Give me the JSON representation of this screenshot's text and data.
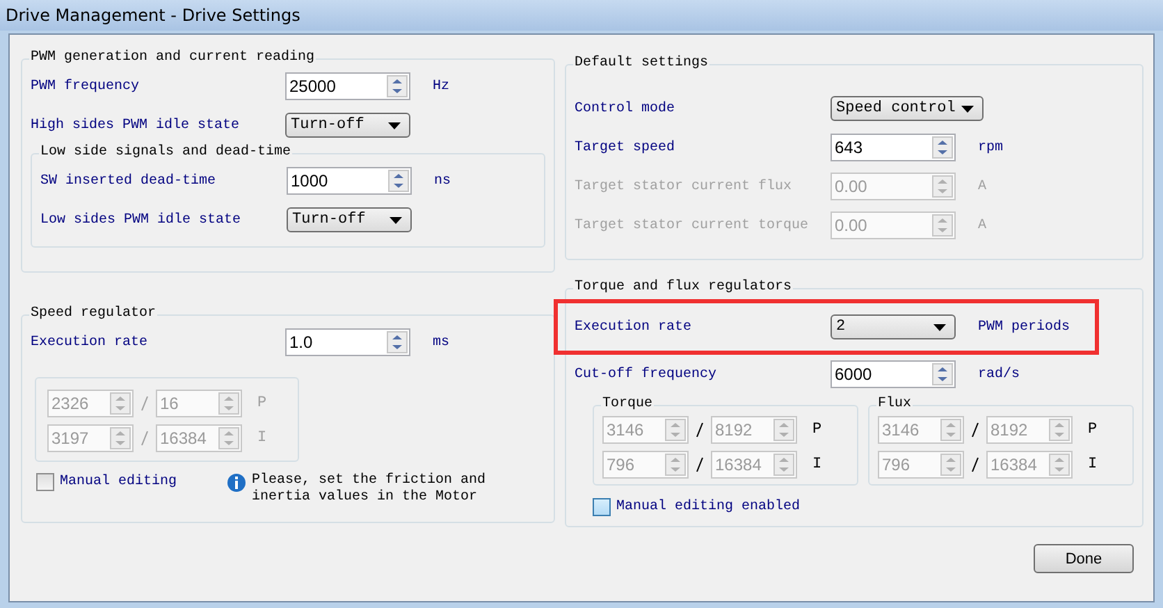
{
  "window": {
    "title": "Drive Management - Drive Settings"
  },
  "columns": [
    [
      {
        "title": "PWM generation and current reading",
        "rows": [
          {
            "kind": "spin",
            "label": "PWM frequency",
            "value": "25000",
            "unit": "Hz",
            "disabled": false,
            "highlighted": false
          },
          {
            "kind": "combo",
            "label": "High sides PWM idle state",
            "value": "Turn-off",
            "disabled": false,
            "highlighted": false
          }
        ],
        "subgroup": {
          "title": "Low side signals and dead-time",
          "rows": [
            {
              "kind": "spin",
              "label": "SW inserted dead-time",
              "value": "1000",
              "unit": "ns",
              "disabled": false,
              "highlighted": false
            },
            {
              "kind": "combo",
              "label": "Low sides PWM idle state",
              "value": "Turn-off",
              "disabled": false,
              "highlighted": false
            }
          ]
        }
      },
      {
        "title": "Speed regulator",
        "rows": [
          {
            "kind": "spin",
            "label": "Execution rate",
            "value": "1.0",
            "unit": "ms",
            "disabled": false,
            "highlighted": false
          }
        ],
        "gain_sets": [
          {
            "labels_disabled": true,
            "fields_disabled": true,
            "rows": [
              {
                "numerator": "2326",
                "denominator": "16",
                "label": "P"
              },
              {
                "numerator": "3197",
                "denominator": "16384",
                "label": "I"
              }
            ]
          }
        ],
        "checkbox": {
          "label": "Manual editing",
          "checked": false,
          "focused": false
        },
        "note": "Please, set the friction and inertia values in the Motor"
      }
    ],
    [
      {
        "title": "Default settings",
        "rows": [
          {
            "kind": "combo",
            "label": "Control mode",
            "value": "Speed control",
            "disabled": false,
            "highlighted": false
          },
          {
            "kind": "spin",
            "label": "Target speed",
            "value": "643",
            "unit": "rpm",
            "disabled": false,
            "highlighted": false
          },
          {
            "kind": "spin",
            "label": "Target stator current flux",
            "value": "0.00",
            "unit": "A",
            "disabled": true,
            "highlighted": false
          },
          {
            "kind": "spin",
            "label": "Target stator current torque",
            "value": "0.00",
            "unit": "A",
            "disabled": true,
            "highlighted": false
          }
        ]
      },
      {
        "title": "Torque and flux regulators",
        "rows": [
          {
            "kind": "combo",
            "label": "Execution rate",
            "value": "2",
            "unit": "PWM periods",
            "disabled": false,
            "highlighted": true
          },
          {
            "kind": "spin",
            "label": "Cut-off frequency",
            "value": "6000",
            "unit": "rad/s",
            "disabled": false,
            "highlighted": false
          }
        ],
        "gain_sets": [
          {
            "title": "Torque",
            "labels_disabled": false,
            "fields_disabled": true,
            "rows": [
              {
                "numerator": "3146",
                "denominator": "8192",
                "label": "P"
              },
              {
                "numerator": "796",
                "denominator": "16384",
                "label": "I"
              }
            ]
          },
          {
            "title": "Flux",
            "labels_disabled": false,
            "fields_disabled": true,
            "rows": [
              {
                "numerator": "3146",
                "denominator": "8192",
                "label": "P"
              },
              {
                "numerator": "796",
                "denominator": "16384",
                "label": "I"
              }
            ]
          }
        ],
        "checkbox": {
          "label": "Manual editing enabled",
          "checked": false,
          "focused": true
        }
      }
    ]
  ],
  "buttons": [
    {
      "label": "Done"
    }
  ]
}
